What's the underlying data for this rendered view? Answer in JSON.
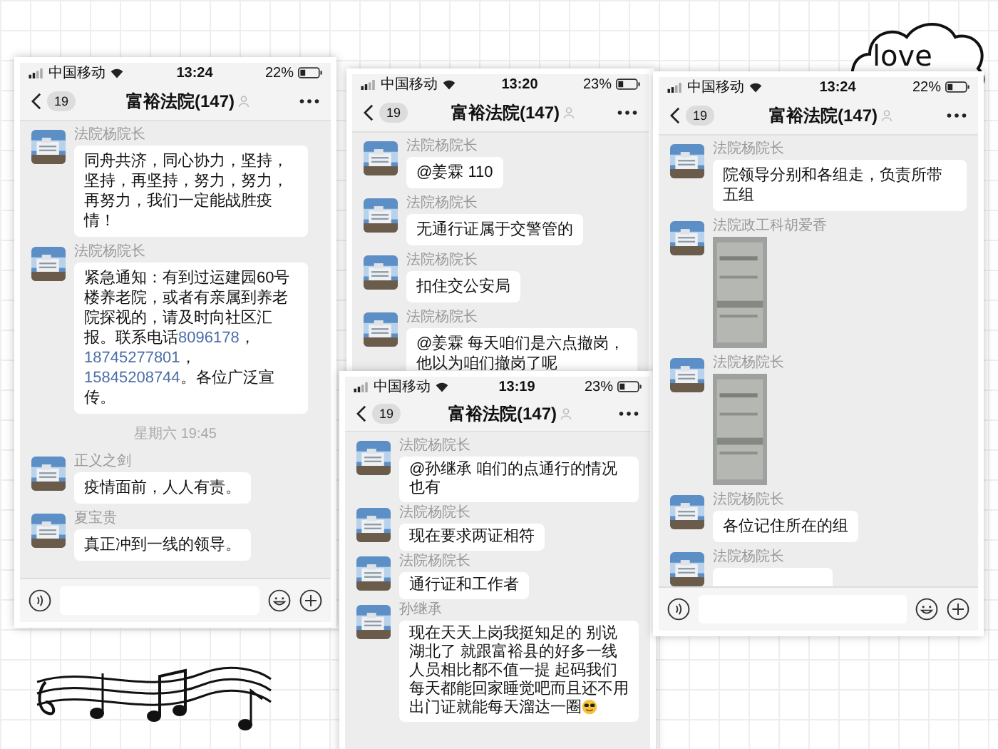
{
  "decoration": {
    "cloud_text": "love"
  },
  "screenshots": [
    {
      "status": {
        "carrier": "中国移动",
        "time": "13:24",
        "battery": "22%"
      },
      "header": {
        "back_count": "19",
        "title": "富裕法院(147)"
      },
      "input_bar": true,
      "messages": [
        {
          "kind": "text",
          "sender": "法院杨院长",
          "segments": [
            {
              "kind": "text",
              "text": "同舟共济，同心协力，坚持，坚持，再坚持，努力，努力，再努力，我们一定能战胜疫情！"
            }
          ]
        },
        {
          "kind": "text",
          "sender": "法院杨院长",
          "segments": [
            {
              "kind": "text",
              "text": "紧急通知：有到过运建园60号楼养老院，或者有亲属到养老院探视的，请及时向社区汇报。联系电话"
            },
            {
              "kind": "link",
              "text": "8096178"
            },
            {
              "kind": "text",
              "text": "，"
            },
            {
              "kind": "link",
              "text": "18745277801"
            },
            {
              "kind": "text",
              "text": "，"
            },
            {
              "kind": "link",
              "text": "15845208744"
            },
            {
              "kind": "text",
              "text": "。各位广泛宣传。"
            }
          ]
        },
        {
          "kind": "time",
          "text": "星期六 19:45"
        },
        {
          "kind": "text",
          "sender": "正义之剑",
          "segments": [
            {
              "kind": "text",
              "text": "疫情面前，人人有责。"
            }
          ]
        },
        {
          "kind": "text",
          "sender": "夏宝贵",
          "segments": [
            {
              "kind": "text",
              "text": "真正冲到一线的领导。"
            }
          ]
        }
      ]
    },
    {
      "status": {
        "carrier": "中国移动",
        "time": "13:20",
        "battery": "23%"
      },
      "header": {
        "back_count": "19",
        "title": "富裕法院(147)"
      },
      "input_bar": false,
      "messages": [
        {
          "kind": "text",
          "sender": "法院杨院长",
          "segments": [
            {
              "kind": "text",
              "text": "@姜霖 110"
            }
          ]
        },
        {
          "kind": "text",
          "sender": "法院杨院长",
          "segments": [
            {
              "kind": "text",
              "text": "无通行证属于交警管的"
            }
          ]
        },
        {
          "kind": "text",
          "sender": "法院杨院长",
          "segments": [
            {
              "kind": "text",
              "text": "扣住交公安局"
            }
          ]
        },
        {
          "kind": "text",
          "sender": "法院杨院长",
          "segments": [
            {
              "kind": "text",
              "text": "@姜霖 每天咱们是六点撤岗，他以为咱们撤岗了呢"
            }
          ]
        }
      ]
    },
    {
      "status": {
        "carrier": "中国移动",
        "time": "13:19",
        "battery": "23%"
      },
      "header": {
        "back_count": "19",
        "title": "富裕法院(147)"
      },
      "input_bar": false,
      "messages": [
        {
          "kind": "text",
          "sender": "法院杨院长",
          "segments": [
            {
              "kind": "text",
              "text": "@孙继承 咱们的点通行的情况也有"
            }
          ]
        },
        {
          "kind": "text",
          "sender": "法院杨院长",
          "segments": [
            {
              "kind": "text",
              "text": "现在要求两证相符"
            }
          ]
        },
        {
          "kind": "text",
          "sender": "法院杨院长",
          "segments": [
            {
              "kind": "text",
              "text": "通行证和工作者"
            }
          ]
        },
        {
          "kind": "text",
          "sender": "孙继承",
          "segments": [
            {
              "kind": "text",
              "text": "现在天天上岗我挺知足的 别说湖北了 就跟富裕县的好多一线人员相比都不值一提 起码我们每天都能回家睡觉吧而且还不用出门证就能每天溜达一圈"
            },
            {
              "kind": "emoji"
            }
          ]
        }
      ]
    },
    {
      "status": {
        "carrier": "中国移动",
        "time": "13:24",
        "battery": "22%"
      },
      "header": {
        "back_count": "19",
        "title": "富裕法院(147)"
      },
      "input_bar": true,
      "messages": [
        {
          "kind": "text",
          "sender": "法院杨院长",
          "segments": [
            {
              "kind": "text",
              "text": "院领导分别和各组走，负责所带五组"
            }
          ]
        },
        {
          "sender": "法院政工科胡爱香"
        },
        {
          "sender": "法院杨院长"
        },
        {
          "kind": "text",
          "sender": "法院杨院长",
          "segments": [
            {
              "kind": "text",
              "text": "各位记住所在的组"
            }
          ]
        },
        {
          "kind": "partial",
          "sender": "法院杨院长"
        }
      ]
    }
  ]
}
